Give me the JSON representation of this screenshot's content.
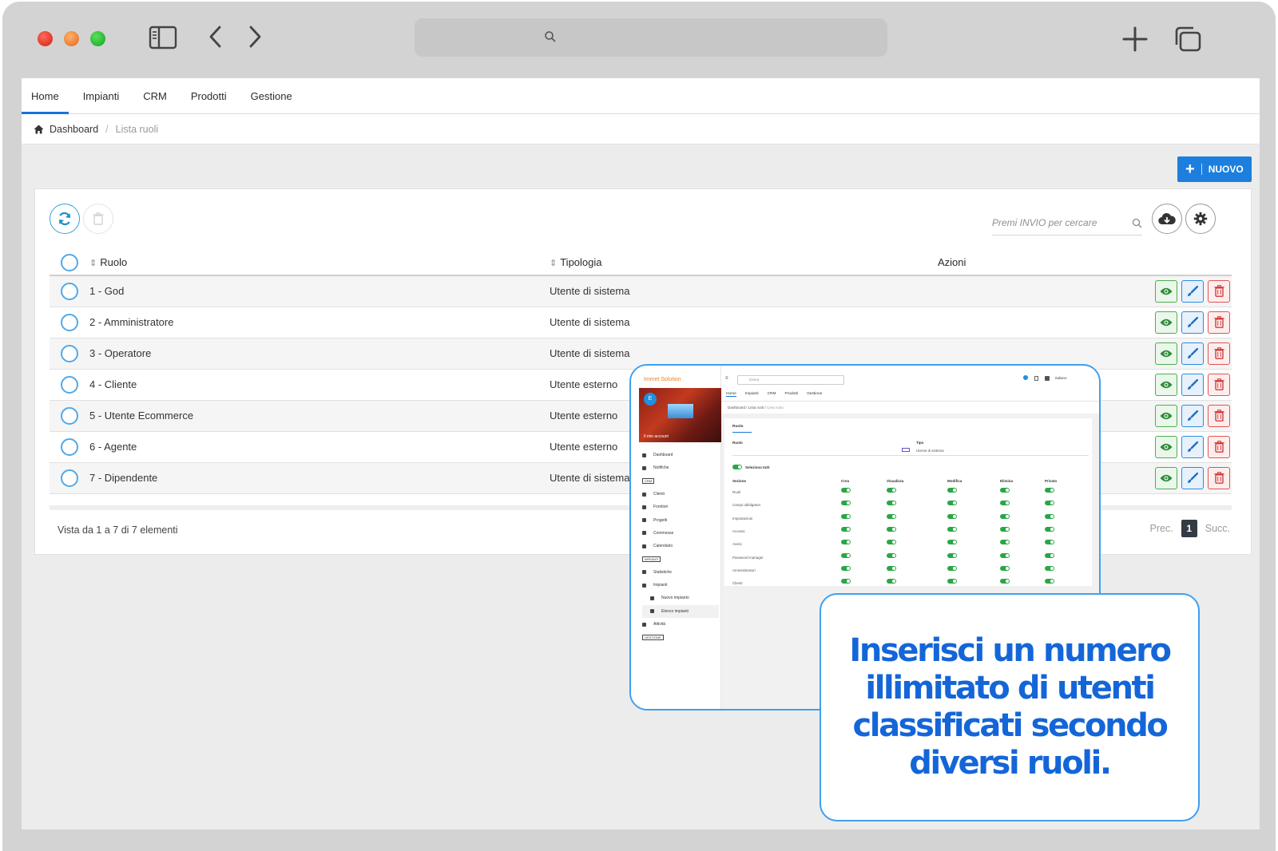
{
  "nav": {
    "items": [
      {
        "label": "Home",
        "active": true
      },
      {
        "label": "Impianti",
        "active": false
      },
      {
        "label": "CRM",
        "active": false
      },
      {
        "label": "Prodotti",
        "active": false
      },
      {
        "label": "Gestione",
        "active": false
      }
    ]
  },
  "breadcrumb": {
    "home": "Dashboard",
    "separator": "/",
    "current": "Lista ruoli"
  },
  "actions": {
    "new_label": "NUOVO"
  },
  "search": {
    "placeholder": "Premi INVIO per cercare"
  },
  "table": {
    "headers": {
      "role": "Ruolo",
      "type": "Tipologia",
      "actions": "Azioni"
    },
    "rows": [
      {
        "role": "1 - God",
        "type": "Utente di sistema"
      },
      {
        "role": "2 - Amministratore",
        "type": "Utente di sistema"
      },
      {
        "role": "3 - Operatore",
        "type": "Utente di sistema"
      },
      {
        "role": "4 - Cliente",
        "type": "Utente esterno"
      },
      {
        "role": "5 - Utente Ecommerce",
        "type": "Utente esterno"
      },
      {
        "role": "6 - Agente",
        "type": "Utente esterno"
      },
      {
        "role": "7 - Dipendente",
        "type": "Utente di sistema"
      }
    ]
  },
  "footer": {
    "info": "Vista da 1 a 7 di 7 elementi",
    "prev": "Prec.",
    "page": "1",
    "next": "Succ."
  },
  "inset": {
    "logo": "Immet Solution",
    "avatar_letter": "E",
    "account": "Il mio account",
    "search_placeholder": "Cerca",
    "language": "Italiano",
    "tabs": [
      "Home",
      "Impianti",
      "CRM",
      "Prodotti",
      "Gestione"
    ],
    "crumb": {
      "home": "Dashboard",
      "list": "Lista ruoli",
      "current": "Crea ruolo"
    },
    "menu": [
      {
        "label": "Dashboard",
        "kind": "item"
      },
      {
        "label": "Notifiche",
        "kind": "item"
      },
      {
        "label": "CRM",
        "kind": "tag"
      },
      {
        "label": "Clienti",
        "kind": "item"
      },
      {
        "label": "Fornitori",
        "kind": "item"
      },
      {
        "label": "Progetti",
        "kind": "item"
      },
      {
        "label": "Commesse",
        "kind": "item"
      },
      {
        "label": "Calendario",
        "kind": "item"
      },
      {
        "label": "IMPIANTI",
        "kind": "tag"
      },
      {
        "label": "Statistiche",
        "kind": "item"
      },
      {
        "label": "Impianti",
        "kind": "item"
      },
      {
        "label": "Nuovo impianto",
        "kind": "sub"
      },
      {
        "label": "Elenco impianti",
        "kind": "sub-hl"
      },
      {
        "label": "Attività",
        "kind": "item"
      },
      {
        "label": "GESTIONE",
        "kind": "tag"
      }
    ],
    "form": {
      "tab": "Ruolo",
      "role_label": "Ruolo",
      "type_label": "Tipo",
      "type_value": "Utente di sistema",
      "select_all": "Seleziona tutti",
      "columns": [
        "Sezione",
        "Crea",
        "Visualizza",
        "Modifica",
        "Elimina",
        "Privato"
      ],
      "sections": [
        "Ruoli",
        "Campi obbligatori",
        "Impostazioni",
        "Accessi",
        "Avvisi",
        "Password manager",
        "Amministratori",
        "Clienti"
      ]
    }
  },
  "callout": {
    "text": "Inserisci un numero illimitato di utenti classificati secondo diversi ruoli."
  },
  "colors": {
    "accent": "#1c7fde",
    "callout_text": "#1466d8",
    "view": "#4caf50",
    "edit": "#2b8be0",
    "delete": "#e05454"
  }
}
